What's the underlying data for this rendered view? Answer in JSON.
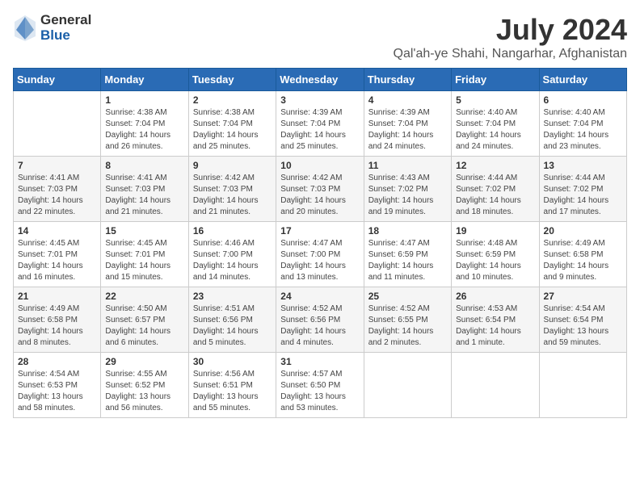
{
  "header": {
    "logo_general": "General",
    "logo_blue": "Blue",
    "month_year": "July 2024",
    "location": "Qal'ah-ye Shahi, Nangarhar, Afghanistan"
  },
  "calendar": {
    "weekdays": [
      "Sunday",
      "Monday",
      "Tuesday",
      "Wednesday",
      "Thursday",
      "Friday",
      "Saturday"
    ],
    "weeks": [
      [
        {
          "day": "",
          "detail": ""
        },
        {
          "day": "1",
          "detail": "Sunrise: 4:38 AM\nSunset: 7:04 PM\nDaylight: 14 hours\nand 26 minutes."
        },
        {
          "day": "2",
          "detail": "Sunrise: 4:38 AM\nSunset: 7:04 PM\nDaylight: 14 hours\nand 25 minutes."
        },
        {
          "day": "3",
          "detail": "Sunrise: 4:39 AM\nSunset: 7:04 PM\nDaylight: 14 hours\nand 25 minutes."
        },
        {
          "day": "4",
          "detail": "Sunrise: 4:39 AM\nSunset: 7:04 PM\nDaylight: 14 hours\nand 24 minutes."
        },
        {
          "day": "5",
          "detail": "Sunrise: 4:40 AM\nSunset: 7:04 PM\nDaylight: 14 hours\nand 24 minutes."
        },
        {
          "day": "6",
          "detail": "Sunrise: 4:40 AM\nSunset: 7:04 PM\nDaylight: 14 hours\nand 23 minutes."
        }
      ],
      [
        {
          "day": "7",
          "detail": "Sunrise: 4:41 AM\nSunset: 7:03 PM\nDaylight: 14 hours\nand 22 minutes."
        },
        {
          "day": "8",
          "detail": "Sunrise: 4:41 AM\nSunset: 7:03 PM\nDaylight: 14 hours\nand 21 minutes."
        },
        {
          "day": "9",
          "detail": "Sunrise: 4:42 AM\nSunset: 7:03 PM\nDaylight: 14 hours\nand 21 minutes."
        },
        {
          "day": "10",
          "detail": "Sunrise: 4:42 AM\nSunset: 7:03 PM\nDaylight: 14 hours\nand 20 minutes."
        },
        {
          "day": "11",
          "detail": "Sunrise: 4:43 AM\nSunset: 7:02 PM\nDaylight: 14 hours\nand 19 minutes."
        },
        {
          "day": "12",
          "detail": "Sunrise: 4:44 AM\nSunset: 7:02 PM\nDaylight: 14 hours\nand 18 minutes."
        },
        {
          "day": "13",
          "detail": "Sunrise: 4:44 AM\nSunset: 7:02 PM\nDaylight: 14 hours\nand 17 minutes."
        }
      ],
      [
        {
          "day": "14",
          "detail": "Sunrise: 4:45 AM\nSunset: 7:01 PM\nDaylight: 14 hours\nand 16 minutes."
        },
        {
          "day": "15",
          "detail": "Sunrise: 4:45 AM\nSunset: 7:01 PM\nDaylight: 14 hours\nand 15 minutes."
        },
        {
          "day": "16",
          "detail": "Sunrise: 4:46 AM\nSunset: 7:00 PM\nDaylight: 14 hours\nand 14 minutes."
        },
        {
          "day": "17",
          "detail": "Sunrise: 4:47 AM\nSunset: 7:00 PM\nDaylight: 14 hours\nand 13 minutes."
        },
        {
          "day": "18",
          "detail": "Sunrise: 4:47 AM\nSunset: 6:59 PM\nDaylight: 14 hours\nand 11 minutes."
        },
        {
          "day": "19",
          "detail": "Sunrise: 4:48 AM\nSunset: 6:59 PM\nDaylight: 14 hours\nand 10 minutes."
        },
        {
          "day": "20",
          "detail": "Sunrise: 4:49 AM\nSunset: 6:58 PM\nDaylight: 14 hours\nand 9 minutes."
        }
      ],
      [
        {
          "day": "21",
          "detail": "Sunrise: 4:49 AM\nSunset: 6:58 PM\nDaylight: 14 hours\nand 8 minutes."
        },
        {
          "day": "22",
          "detail": "Sunrise: 4:50 AM\nSunset: 6:57 PM\nDaylight: 14 hours\nand 6 minutes."
        },
        {
          "day": "23",
          "detail": "Sunrise: 4:51 AM\nSunset: 6:56 PM\nDaylight: 14 hours\nand 5 minutes."
        },
        {
          "day": "24",
          "detail": "Sunrise: 4:52 AM\nSunset: 6:56 PM\nDaylight: 14 hours\nand 4 minutes."
        },
        {
          "day": "25",
          "detail": "Sunrise: 4:52 AM\nSunset: 6:55 PM\nDaylight: 14 hours\nand 2 minutes."
        },
        {
          "day": "26",
          "detail": "Sunrise: 4:53 AM\nSunset: 6:54 PM\nDaylight: 14 hours\nand 1 minute."
        },
        {
          "day": "27",
          "detail": "Sunrise: 4:54 AM\nSunset: 6:54 PM\nDaylight: 13 hours\nand 59 minutes."
        }
      ],
      [
        {
          "day": "28",
          "detail": "Sunrise: 4:54 AM\nSunset: 6:53 PM\nDaylight: 13 hours\nand 58 minutes."
        },
        {
          "day": "29",
          "detail": "Sunrise: 4:55 AM\nSunset: 6:52 PM\nDaylight: 13 hours\nand 56 minutes."
        },
        {
          "day": "30",
          "detail": "Sunrise: 4:56 AM\nSunset: 6:51 PM\nDaylight: 13 hours\nand 55 minutes."
        },
        {
          "day": "31",
          "detail": "Sunrise: 4:57 AM\nSunset: 6:50 PM\nDaylight: 13 hours\nand 53 minutes."
        },
        {
          "day": "",
          "detail": ""
        },
        {
          "day": "",
          "detail": ""
        },
        {
          "day": "",
          "detail": ""
        }
      ]
    ]
  }
}
